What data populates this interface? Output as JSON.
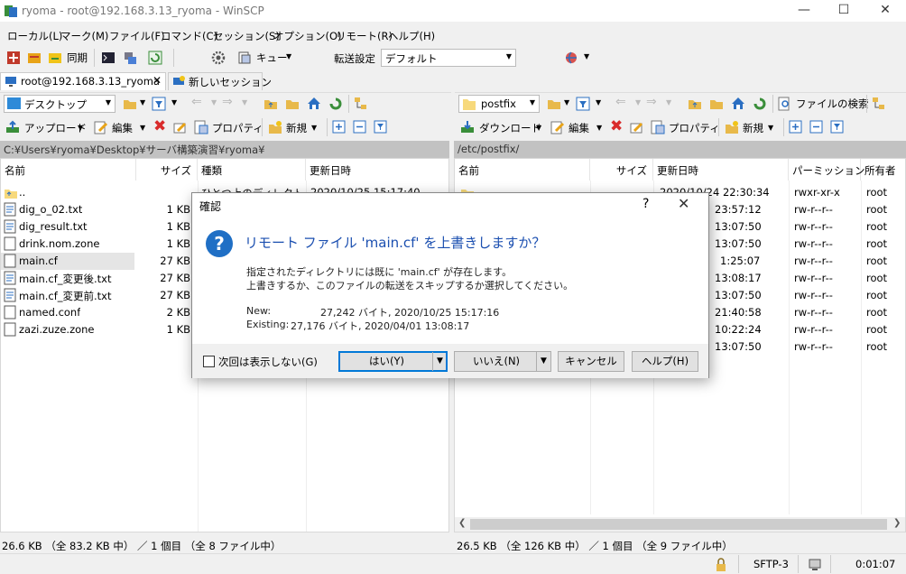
{
  "window": {
    "title": "ryoma - root@192.168.3.13_ryoma - WinSCP"
  },
  "menu": [
    "ローカル(L)",
    "マーク(M)",
    "ファイル(F)",
    "コマンド(C)",
    "セッション(S)",
    "オプション(O)",
    "リモート(R)",
    "ヘルプ(H)"
  ],
  "toolbar": {
    "sync_label": "同期",
    "queue_label": "キュー",
    "transfer_label": "転送設定",
    "transfer_value": "デフォルト"
  },
  "tabs": {
    "active": "root@192.168.3.13_ryoma",
    "new_session": "新しいセッション"
  },
  "left": {
    "location": "デスクトップ",
    "upload": "アップロード",
    "edit": "編集",
    "properties": "プロパティ",
    "new": "新規",
    "path": "C:¥Users¥ryoma¥Desktop¥サーバ構築演習¥ryoma¥",
    "columns": [
      "名前",
      "サイズ",
      "種類",
      "更新日時"
    ],
    "files": [
      {
        "name": "..",
        "size": "",
        "type": "ひとつ上のディレクトリ",
        "date": "2020/10/25  15:17:40"
      },
      {
        "name": "dig_o_02.txt",
        "size": "1 KB",
        "type": "",
        "date": ""
      },
      {
        "name": "dig_result.txt",
        "size": "1 KB",
        "type": "",
        "date": ""
      },
      {
        "name": "drink.nom.zone",
        "size": "1 KB",
        "type": "",
        "date": ""
      },
      {
        "name": "main.cf",
        "size": "27 KB",
        "type": "",
        "date": ""
      },
      {
        "name": "main.cf_変更後.txt",
        "size": "27 KB",
        "type": "",
        "date": ""
      },
      {
        "name": "main.cf_変更前.txt",
        "size": "27 KB",
        "type": "",
        "date": ""
      },
      {
        "name": "named.conf",
        "size": "2 KB",
        "type": "",
        "date": ""
      },
      {
        "name": "zazi.zuze.zone",
        "size": "1 KB",
        "type": "",
        "date": ""
      }
    ],
    "status": "26.6 KB （全 83.2 KB 中） ／ 1 個目 （全 8 ファイル中）"
  },
  "right": {
    "location": "postfix",
    "download": "ダウンロード",
    "edit": "編集",
    "properties": "プロパティ",
    "new": "新規",
    "find": "ファイルの検索",
    "path": "/etc/postfix/",
    "columns": [
      "名前",
      "サイズ",
      "更新日時",
      "パーミッション",
      "所有者"
    ],
    "files": [
      {
        "date": "2020/10/24  22:30:34",
        "perm": "rwxr-xr-x",
        "owner": "root"
      },
      {
        "date": "23:57:12",
        "perm": "rw-r--r--",
        "owner": "root"
      },
      {
        "date": "13:07:50",
        "perm": "rw-r--r--",
        "owner": "root"
      },
      {
        "date": "13:07:50",
        "perm": "rw-r--r--",
        "owner": "root"
      },
      {
        "date": "1:25:07",
        "perm": "rw-r--r--",
        "owner": "root"
      },
      {
        "date": "13:08:17",
        "perm": "rw-r--r--",
        "owner": "root"
      },
      {
        "date": "13:07:50",
        "perm": "rw-r--r--",
        "owner": "root"
      },
      {
        "date": "21:40:58",
        "perm": "rw-r--r--",
        "owner": "root"
      },
      {
        "date": "10:22:24",
        "perm": "rw-r--r--",
        "owner": "root"
      },
      {
        "date": "13:07:50",
        "perm": "rw-r--r--",
        "owner": "root"
      }
    ],
    "status": "26.5 KB （全 126 KB 中） ／ 1 個目 （全 9 ファイル中）"
  },
  "statusbar": {
    "protocol": "SFTP-3",
    "time": "0:01:07"
  },
  "dialog": {
    "title": "確認",
    "help_glyph": "?",
    "heading": "リモート ファイル 'main.cf' を上書きしますか？",
    "line1": "指定されたディレクトリには既に 'main.cf' が存在します。",
    "line2": "上書きするか、このファイルの転送をスキップするか選択してください。",
    "new_label": "New:",
    "new_value": "27,242 バイト, 2020/10/25 15:17:16",
    "existing_label": "Existing:",
    "existing_value": "27,176 バイト, 2020/04/01 13:08:17",
    "checkbox_label": "次回は表示しない(G)",
    "yes": "はい(Y)",
    "no": "いいえ(N)",
    "cancel": "キャンセル",
    "help": "ヘルプ(H)"
  }
}
